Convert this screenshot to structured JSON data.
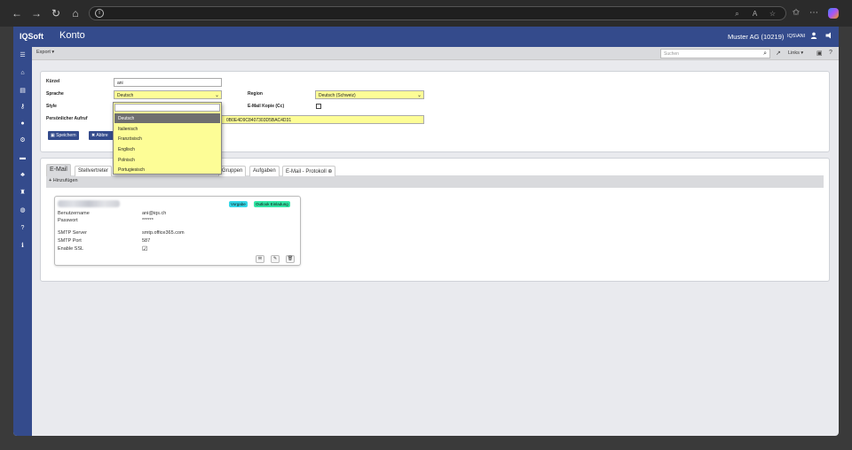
{
  "browser": {
    "back": "←",
    "forward": "→",
    "reload": "↻",
    "home": "⌂",
    "info": "i"
  },
  "app": {
    "logo": "IQSoft",
    "module": "Konto",
    "company": "Muster AG (10219)",
    "user": "IQS\\ANI"
  },
  "toolbar": {
    "export": "Export ▾",
    "search_placeholder": "Suchen",
    "links": "Links ▾"
  },
  "form": {
    "kuerzel_label": "Kürzel",
    "kuerzel_value": "ani",
    "sprache_label": "Sprache",
    "sprache_value": "Deutsch",
    "region_label": "Region",
    "region_value": "Deutsch (Schweiz)",
    "style_label": "Style",
    "email_kopie_label": "E-Mail Kopie (Cc)",
    "aufruf_label": "Persönlicher Aufruf",
    "aufruf_value": "0B0E4D9C8407303D5BAC4D31",
    "save_label": "Speichern",
    "cancel_label": "Abbre"
  },
  "dropdown": {
    "options": [
      "Deutsch",
      "Italienisch",
      "Französisch",
      "Englisch",
      "Polnisch",
      "Portugiesisch"
    ],
    "selected": "Deutsch"
  },
  "tabs": [
    {
      "label": "E-Mail"
    },
    {
      "label": "Stellvertreter"
    },
    {
      "label": "Gruppen"
    },
    {
      "label": "Aufgaben"
    },
    {
      "label": "E-Mail - Protokoll"
    }
  ],
  "add_label": "Hinzufügen",
  "card": {
    "badge_vorgabe": "Vorgabe",
    "badge_outlook": "Outlook Einladung",
    "fields": [
      {
        "key": "Benutzername",
        "value": "ani@iqs.ch"
      },
      {
        "key": "Passwort",
        "value": "******"
      },
      {
        "key": "SMTP Server",
        "value": "smtp.office365.com"
      },
      {
        "key": "SMTP Port",
        "value": "587"
      },
      {
        "key": "Enable SSL",
        "value": ""
      }
    ]
  },
  "colors": {
    "brand": "#344b8c",
    "highlight": "#fdfd96",
    "badge_cyan": "#33d6e6",
    "badge_green": "#33e6a6"
  }
}
